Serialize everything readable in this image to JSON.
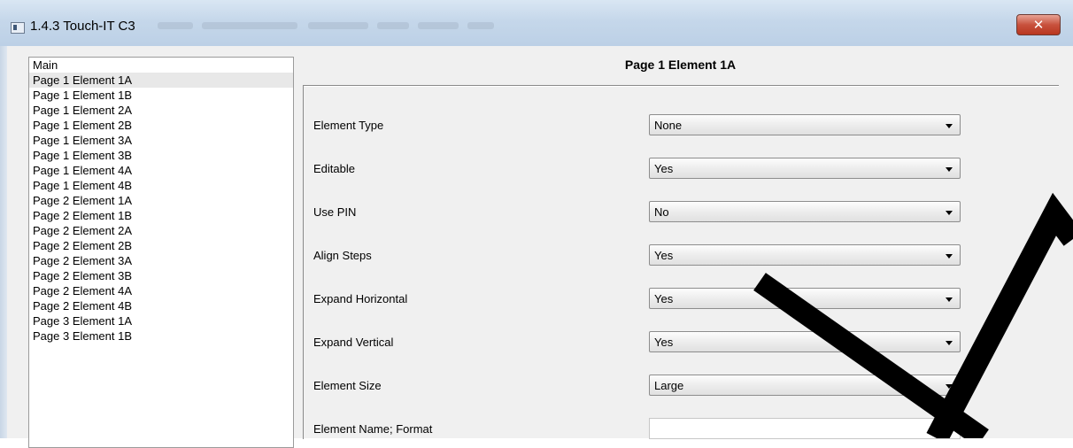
{
  "window": {
    "title": "1.4.3 Touch-IT C3",
    "close_icon": "close-icon"
  },
  "nav": {
    "items": [
      {
        "label": "Main"
      },
      {
        "label": "Page 1 Element 1A",
        "selected": true
      },
      {
        "label": "Page 1 Element 1B"
      },
      {
        "label": "Page 1 Element 2A"
      },
      {
        "label": "Page 1 Element 2B"
      },
      {
        "label": "Page 1 Element 3A"
      },
      {
        "label": "Page 1 Element 3B"
      },
      {
        "label": "Page 1 Element 4A"
      },
      {
        "label": "Page 1 Element 4B"
      },
      {
        "label": "Page 2 Element 1A"
      },
      {
        "label": "Page 2 Element 1B"
      },
      {
        "label": "Page 2 Element 2A"
      },
      {
        "label": "Page 2 Element 2B"
      },
      {
        "label": "Page 2 Element 3A"
      },
      {
        "label": "Page 2 Element 3B"
      },
      {
        "label": "Page 2 Element 4A"
      },
      {
        "label": "Page 2 Element 4B"
      },
      {
        "label": "Page 3 Element 1A"
      },
      {
        "label": "Page 3 Element 1B"
      }
    ]
  },
  "panel": {
    "title": "Page 1 Element 1A",
    "fields": [
      {
        "label": "Element Type",
        "value": "None"
      },
      {
        "label": "Editable",
        "value": "Yes"
      },
      {
        "label": "Use PIN",
        "value": "No"
      },
      {
        "label": "Align Steps",
        "value": "Yes"
      },
      {
        "label": "Expand Horizontal",
        "value": "Yes"
      },
      {
        "label": "Expand Vertical",
        "value": "Yes"
      },
      {
        "label": "Element Size",
        "value": "Large"
      },
      {
        "label": "Element Name; Format",
        "value": ""
      }
    ]
  },
  "colors": {
    "titlebar": "#c5d7ea",
    "close": "#c8513d",
    "selected_row": "#e8e8e8"
  }
}
